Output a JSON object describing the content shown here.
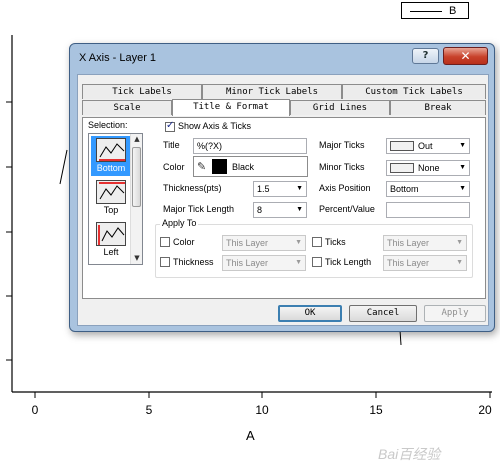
{
  "background": {
    "legend_label": "B",
    "x_ticks": [
      "0",
      "5",
      "10",
      "15",
      "20"
    ],
    "x_axis_title": "A",
    "watermark": "Bai百经验"
  },
  "dialog": {
    "title": "X Axis - Layer 1",
    "help_label": "?",
    "close_label": "✕",
    "tabs_top": [
      "Tick Labels",
      "Minor Tick Labels",
      "Custom Tick Labels"
    ],
    "tabs_bottom": [
      "Scale",
      "Title & Format",
      "Grid Lines",
      "Break"
    ],
    "active_tab": "Title & Format",
    "selection": {
      "label": "Selection:",
      "items": [
        "Bottom",
        "Top",
        "Left"
      ],
      "selected": "Bottom"
    },
    "show_axis_ticks": {
      "label": "Show Axis & Ticks",
      "checked": true
    },
    "title_field": {
      "label": "Title",
      "value": "%(?X)"
    },
    "color_field": {
      "label": "Color",
      "value": "Black"
    },
    "thickness": {
      "label": "Thickness(pts)",
      "value": "1.5"
    },
    "major_tick_length": {
      "label": "Major Tick Length",
      "value": "8"
    },
    "major_ticks": {
      "label": "Major Ticks",
      "value": "Out"
    },
    "minor_ticks": {
      "label": "Minor Ticks",
      "value": "None"
    },
    "axis_position": {
      "label": "Axis Position",
      "value": "Bottom"
    },
    "percent_value": {
      "label": "Percent/Value",
      "value": ""
    },
    "apply_to": {
      "title": "Apply To",
      "rows": [
        {
          "left_label": "Color",
          "left_value": "This Layer",
          "right_label": "Ticks",
          "right_value": "This Layer"
        },
        {
          "left_label": "Thickness",
          "left_value": "This Layer",
          "right_label": "Tick Length",
          "right_value": "This Layer"
        }
      ]
    },
    "buttons": {
      "ok": "OK",
      "cancel": "Cancel",
      "apply": "Apply"
    }
  }
}
